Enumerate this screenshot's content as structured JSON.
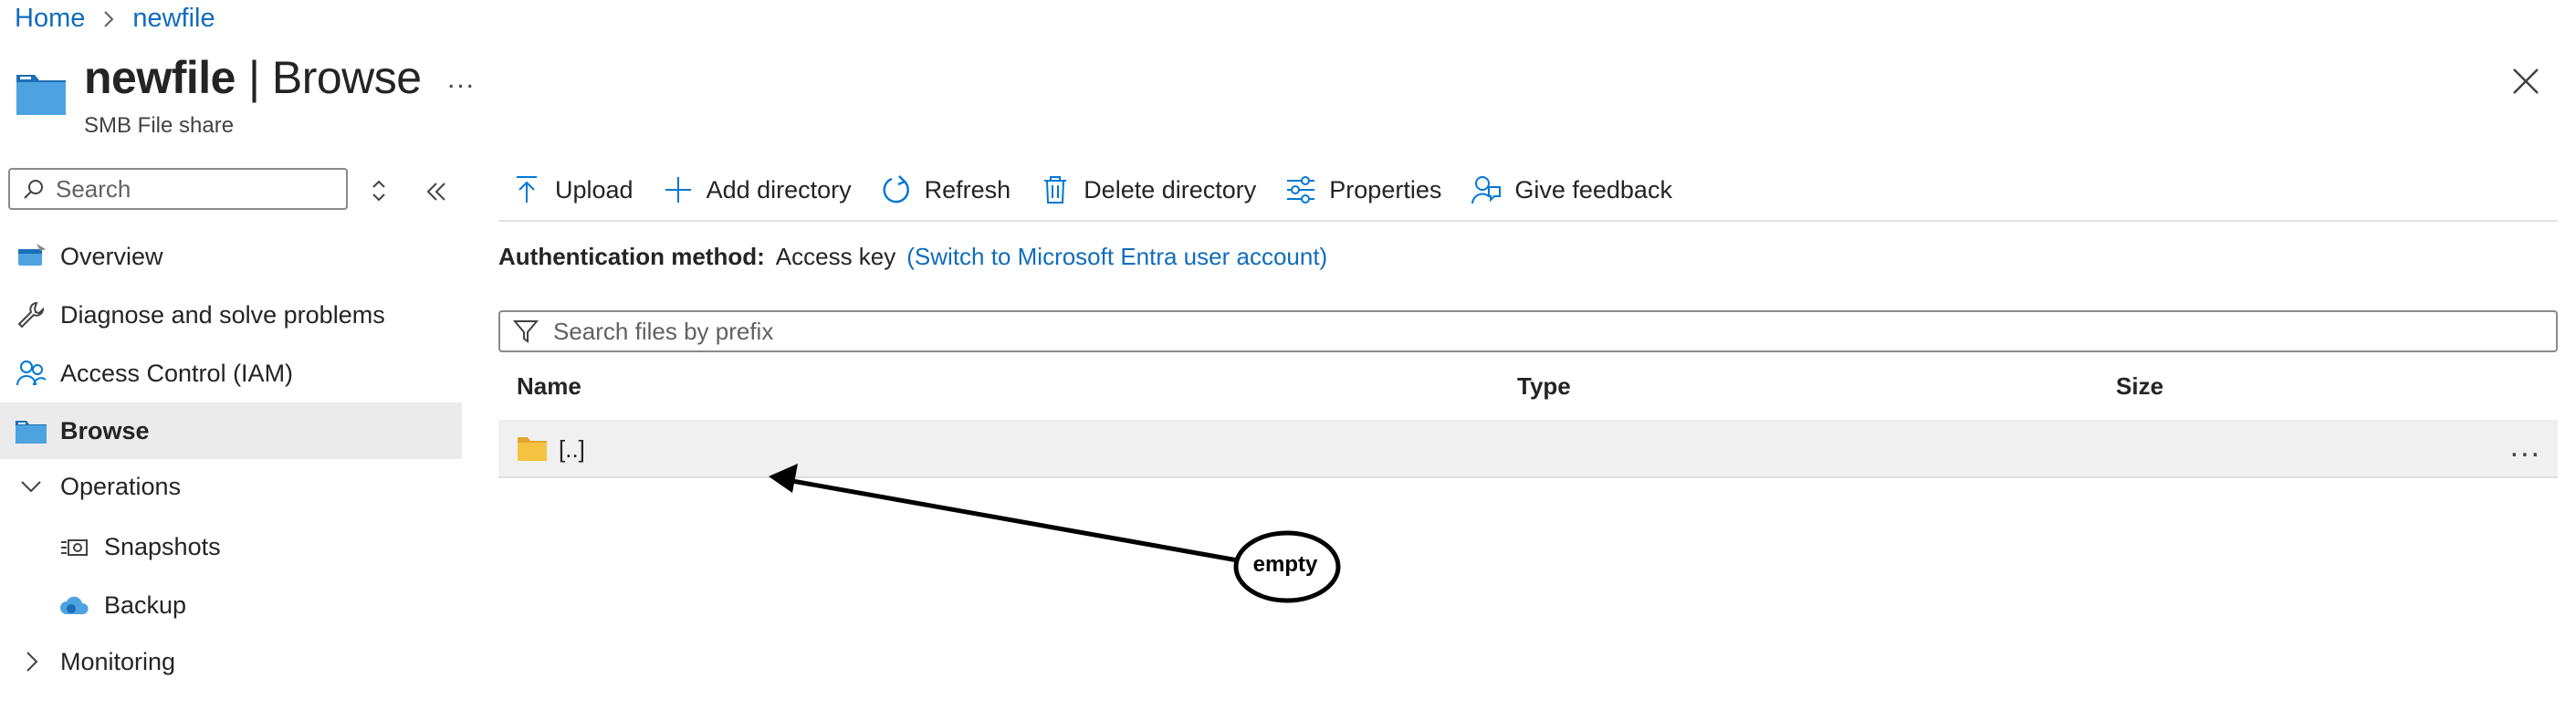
{
  "breadcrumb": {
    "home": "Home",
    "current": "newfile"
  },
  "header": {
    "title": "newfile",
    "title_rest": "| Browse",
    "subtitle": "SMB File share",
    "more": "...",
    "close_icon": "close-icon"
  },
  "sidebar": {
    "search_placeholder": "Search",
    "items": [
      {
        "label": "Overview",
        "icon": "overview-icon"
      },
      {
        "label": "Diagnose and solve problems",
        "icon": "wrench-icon"
      },
      {
        "label": "Access Control (IAM)",
        "icon": "people-icon"
      },
      {
        "label": "Browse",
        "icon": "folder-icon",
        "active": true
      },
      {
        "label": "Operations",
        "icon": "chevron-down-icon",
        "expanded": true
      },
      {
        "label": "Snapshots",
        "icon": "snapshot-icon"
      },
      {
        "label": "Backup",
        "icon": "cloud-backup-icon"
      },
      {
        "label": "Monitoring",
        "icon": "chevron-right-icon",
        "expanded": false
      }
    ]
  },
  "toolbar": {
    "upload": "Upload",
    "add_directory": "Add directory",
    "refresh": "Refresh",
    "delete_directory": "Delete directory",
    "properties": "Properties",
    "give_feedback": "Give feedback"
  },
  "auth": {
    "label": "Authentication method:",
    "value": "Access key",
    "switch_link": "(Switch to Microsoft Entra user account)"
  },
  "filter": {
    "placeholder": "Search files by prefix"
  },
  "table": {
    "columns": [
      "Name",
      "Type",
      "Size"
    ],
    "rows": [
      {
        "name": "[..]",
        "type": "",
        "size": ""
      }
    ],
    "row_more": "..."
  },
  "annotation": {
    "label": "empty"
  },
  "colors": {
    "link": "#0f6cbd",
    "accent": "#0078d4",
    "folder": "#f5c342"
  }
}
